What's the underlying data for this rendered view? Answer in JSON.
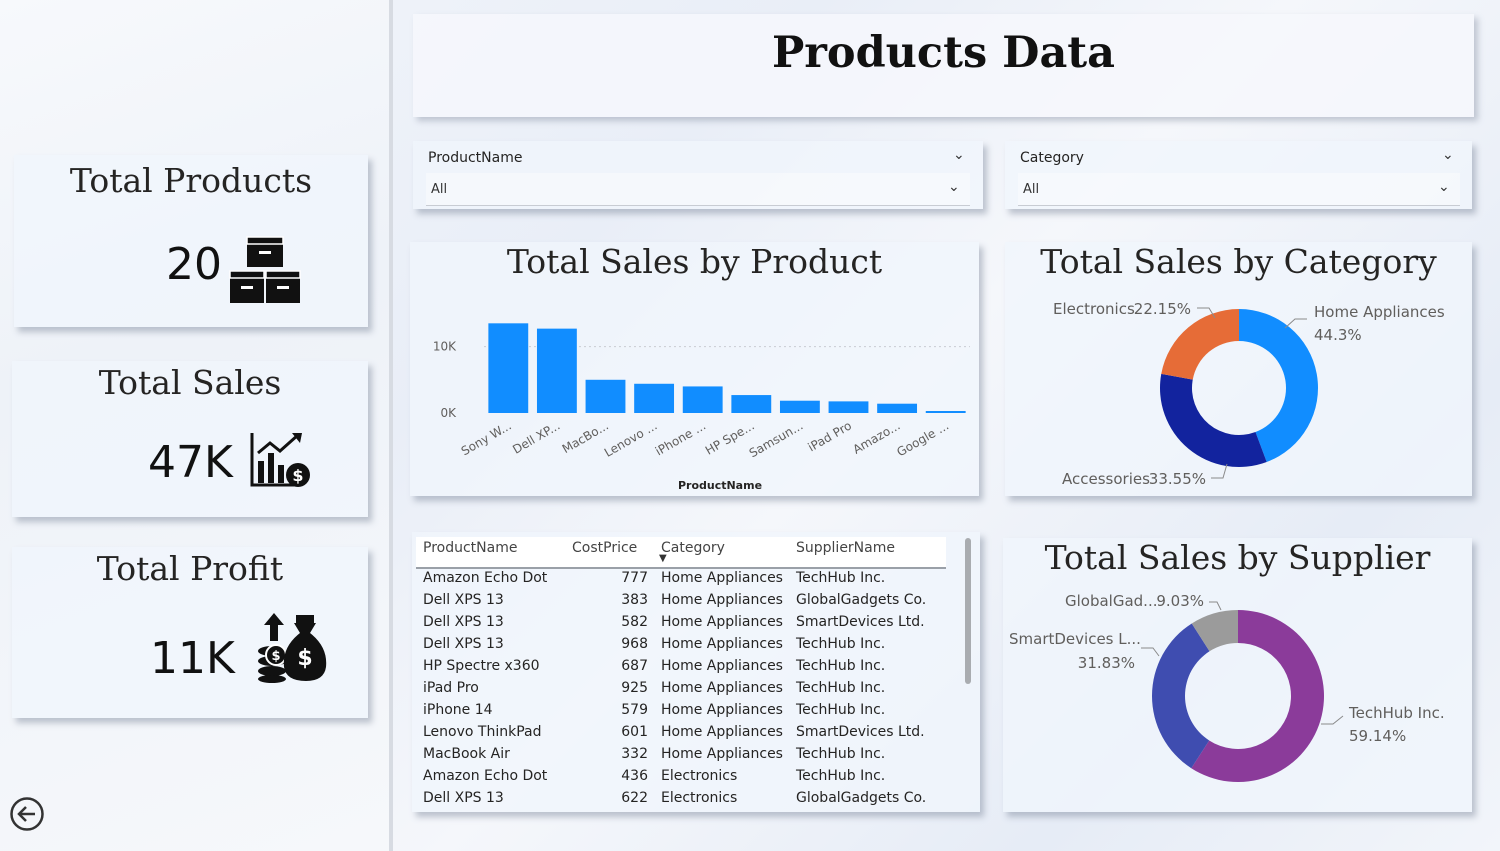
{
  "page": {
    "title": "Products Data"
  },
  "kpis": [
    {
      "title": "Total Products",
      "value": "20",
      "icon": "archive-boxes-icon"
    },
    {
      "title": "Total Sales",
      "value": "47K",
      "icon": "sales-chart-dollar-icon"
    },
    {
      "title": "Total Profit",
      "value": "11K",
      "icon": "money-bag-icon"
    }
  ],
  "slicers": [
    {
      "label": "ProductName",
      "value": "All"
    },
    {
      "label": "Category",
      "value": "All"
    }
  ],
  "colors": {
    "bar": "#118DFF",
    "category": {
      "Home Appliances": "#118DFF",
      "Accessories": "#12239E",
      "Electronics": "#E66C37"
    },
    "supplier": {
      "TechHub Inc.": "#8B3B9A",
      "SmartDevices Ltd.": "#3F4DB0",
      "GlobalGadgets Co.": "#9B9B9B"
    }
  },
  "chart_data": [
    {
      "type": "bar",
      "title": "Total Sales by Product",
      "xlabel": "ProductName",
      "ylabel": "",
      "categories": [
        "Sony W...",
        "Dell XP...",
        "MacBo...",
        "Lenovo ...",
        "iPhone ...",
        "HP Spe...",
        "Samsun...",
        "iPad Pro",
        "Amazo...",
        "Google ..."
      ],
      "values": [
        13500,
        12700,
        5000,
        4400,
        4000,
        2700,
        1850,
        1750,
        1400,
        300
      ],
      "yticks": [
        "0K",
        "10K"
      ],
      "ylim": [
        0,
        14000
      ],
      "grid": true
    },
    {
      "type": "pie",
      "title": "Total Sales by Category",
      "labels": [
        "Home Appliances",
        "Accessories",
        "Electronics"
      ],
      "values": [
        44.3,
        33.55,
        22.15
      ],
      "data_labels": [
        {
          "name": "Home Appliances",
          "value": "44.3%"
        },
        {
          "name": "Accessories",
          "value": "33.55%"
        },
        {
          "name": "Electronics",
          "value": "22.15%"
        }
      ]
    },
    {
      "type": "pie",
      "title": "Total Sales by Supplier",
      "labels": [
        "TechHub Inc.",
        "SmartDevices Ltd.",
        "GlobalGadgets Co."
      ],
      "values": [
        59.14,
        31.83,
        9.03
      ],
      "data_labels": [
        {
          "name": "TechHub Inc.",
          "value": "59.14%"
        },
        {
          "name": "SmartDevices L...",
          "value": "31.83%"
        },
        {
          "name": "GlobalGad...",
          "value": "9.03%"
        }
      ]
    },
    {
      "type": "table",
      "columns": [
        "ProductName",
        "CostPrice",
        "Category",
        "SupplierName"
      ],
      "rows": [
        [
          "Amazon Echo Dot",
          "777",
          "Home Appliances",
          "TechHub Inc."
        ],
        [
          "Dell XPS 13",
          "383",
          "Home Appliances",
          "GlobalGadgets Co."
        ],
        [
          "Dell XPS 13",
          "582",
          "Home Appliances",
          "SmartDevices Ltd."
        ],
        [
          "Dell XPS 13",
          "968",
          "Home Appliances",
          "TechHub Inc."
        ],
        [
          "HP Spectre x360",
          "687",
          "Home Appliances",
          "TechHub Inc."
        ],
        [
          "iPad Pro",
          "925",
          "Home Appliances",
          "TechHub Inc."
        ],
        [
          "iPhone 14",
          "579",
          "Home Appliances",
          "TechHub Inc."
        ],
        [
          "Lenovo ThinkPad",
          "601",
          "Home Appliances",
          "SmartDevices Ltd."
        ],
        [
          "MacBook Air",
          "332",
          "Home Appliances",
          "TechHub Inc."
        ],
        [
          "Amazon Echo Dot",
          "436",
          "Electronics",
          "TechHub Inc."
        ],
        [
          "Dell XPS 13",
          "622",
          "Electronics",
          "GlobalGadgets Co."
        ]
      ]
    }
  ]
}
